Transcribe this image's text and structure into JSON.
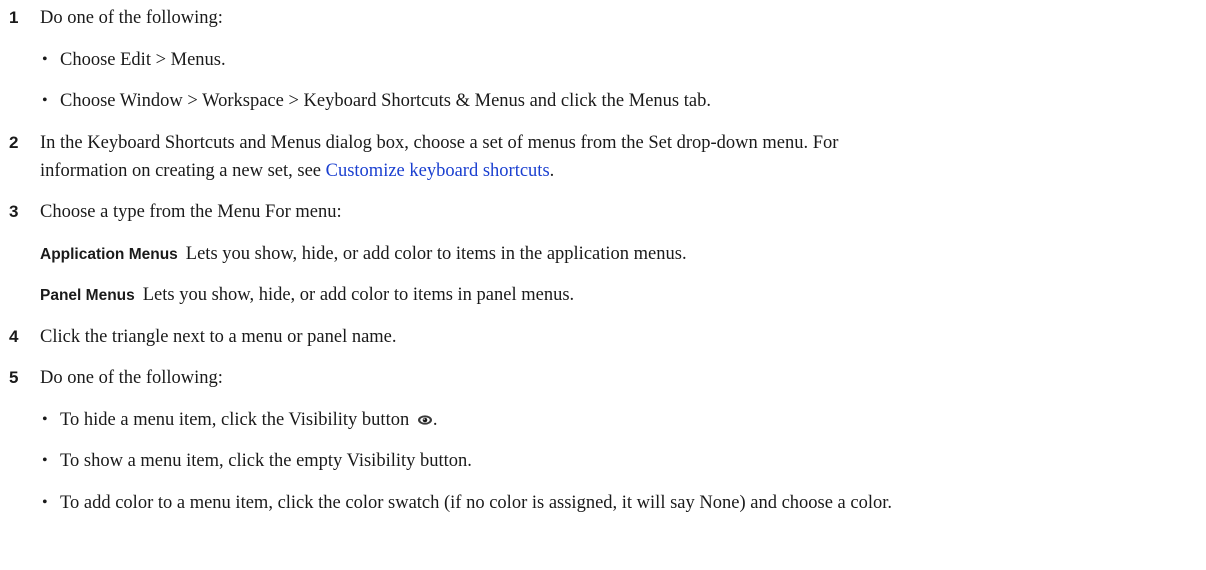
{
  "steps": [
    {
      "number": "1",
      "text": "Do one of the following:",
      "bullets": [
        "Choose Edit > Menus.",
        "Choose Window > Workspace > Keyboard Shortcuts & Menus and click the Menus tab."
      ]
    },
    {
      "number": "2",
      "line1": "In the Keyboard Shortcuts and Menus dialog box, choose a set of menus from the Set drop-down menu. For",
      "line2_before": "information on creating a new set, see ",
      "link": "Customize keyboard shortcuts",
      "line2_after": "."
    },
    {
      "number": "3",
      "text": "Choose a type from the Menu For menu:",
      "definitions": [
        {
          "term": "Application Menus",
          "desc": "Lets you show, hide, or add color to items in the application menus."
        },
        {
          "term": "Panel Menus",
          "desc": "Lets you show, hide, or add color to items in panel menus."
        }
      ]
    },
    {
      "number": "4",
      "text": "Click the triangle next to a menu or panel name."
    },
    {
      "number": "5",
      "text": "Do one of the following:",
      "bullets": [
        {
          "before_icon": "To hide a menu item, click the Visibility button ",
          "icon": "eye-icon",
          "after_icon": "."
        },
        "To show a menu item, click the empty Visibility button.",
        "To add color to a menu item, click the color swatch (if no color is assigned, it will say None) and choose a color."
      ]
    }
  ],
  "colors": {
    "text": "#1a1a1a",
    "link": "#1a3fd0"
  }
}
